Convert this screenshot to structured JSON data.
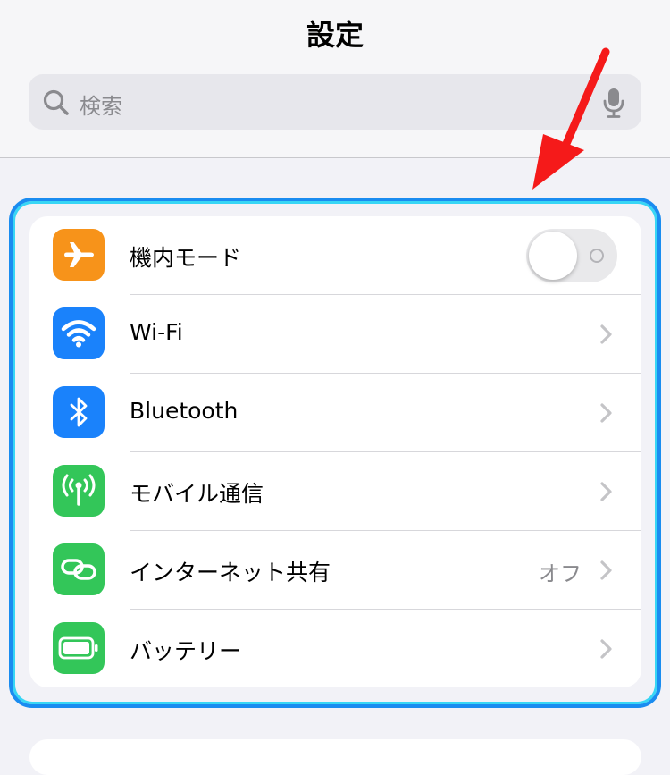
{
  "header": {
    "title": "設定"
  },
  "search": {
    "placeholder": "検索"
  },
  "rows": [
    {
      "label": "機内モード",
      "icon": "airplane-icon",
      "color": "#f7931a",
      "control": "toggle",
      "toggle_on": false
    },
    {
      "label": "Wi-Fi",
      "icon": "wifi-icon",
      "color": "#1a82fb"
    },
    {
      "label": "Bluetooth",
      "icon": "bluetooth-icon",
      "color": "#1a82fb"
    },
    {
      "label": "モバイル通信",
      "icon": "antenna-icon",
      "color": "#33c659"
    },
    {
      "label": "インターネット共有",
      "icon": "link-icon",
      "color": "#33c659",
      "detail": "オフ"
    },
    {
      "label": "バッテリー",
      "icon": "battery-icon",
      "color": "#33c659"
    }
  ],
  "annotation": {
    "arrow_color": "#f51a1a",
    "highlight_color": "#1a8cf0"
  }
}
